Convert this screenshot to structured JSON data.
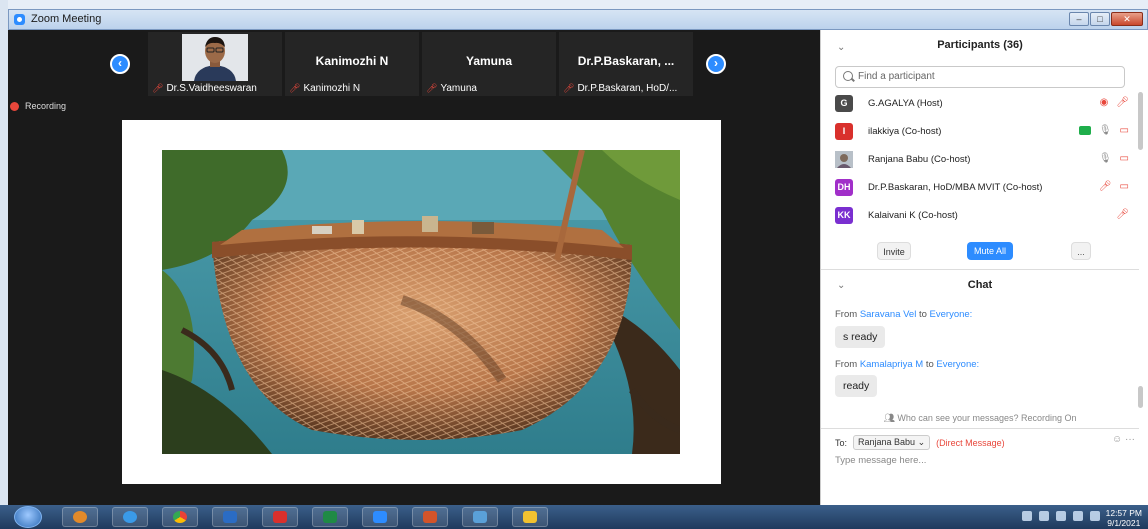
{
  "window": {
    "title": "Zoom Meeting"
  },
  "video_strip": {
    "prev_icon": "chevron-left-icon",
    "next_icon": "chevron-right-icon",
    "tiles": [
      {
        "big_name": "",
        "label": "Dr.S.Vaidheeswaran",
        "has_photo": true
      },
      {
        "big_name": "Kanimozhi N",
        "label": "Kanimozhi N"
      },
      {
        "big_name": "Yamuna",
        "label": "Yamuna"
      },
      {
        "big_name": "Dr.P.Baskaran, ...",
        "label": "Dr.P.Baskaran, HoD/..."
      }
    ]
  },
  "recording": {
    "label": "Recording"
  },
  "participants": {
    "title": "Participants (36)",
    "search_placeholder": "Find a participant",
    "list": [
      {
        "initials": "G",
        "color": "#4a4a4a",
        "name": "G.AGALYA (Host)"
      },
      {
        "initials": "I",
        "color": "#d9302c",
        "name": "ilakkiya (Co-host)"
      },
      {
        "initials": "",
        "color": "#9aa3ad",
        "name": "Ranjana Babu (Co-host)"
      },
      {
        "initials": "DH",
        "color": "#a12fc9",
        "name": "Dr.P.Baskaran, HoD/MBA MVIT (Co-host)"
      },
      {
        "initials": "KK",
        "color": "#7a2fd0",
        "name": "Kalaivani K (Co-host)"
      }
    ],
    "buttons": {
      "invite": "Invite",
      "mute_all": "Mute All",
      "more": "..."
    }
  },
  "chat": {
    "title": "Chat",
    "messages": [
      {
        "from_prefix": "From",
        "sender": "Saravana Vel",
        "to_word": "to",
        "recipient": "Everyone:",
        "text": "s ready"
      },
      {
        "from_prefix": "From",
        "sender": "Kamalapriya M",
        "to_word": "to",
        "recipient": "Everyone:",
        "text": "ready"
      }
    ],
    "info": "Who can see your messages? Recording On",
    "to_label": "To:",
    "to_value": "Ranjana Babu",
    "direct_message": "(Direct Message)",
    "input_placeholder": "Type message here..."
  },
  "taskbar": {
    "time": "12:57 PM",
    "date": "9/1/2021"
  }
}
